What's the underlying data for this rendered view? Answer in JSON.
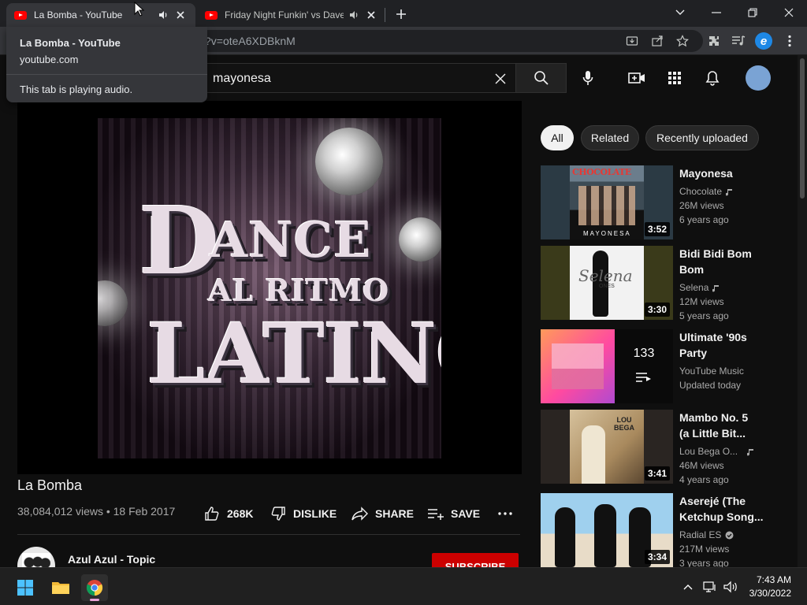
{
  "browser": {
    "tabs": [
      {
        "title": "La Bomba - YouTube",
        "active": true
      },
      {
        "title": "Friday Night Funkin' vs Dave and Bambi",
        "active": false
      }
    ],
    "url_visible": "?v=oteA6XDBknM",
    "hover_card": {
      "title": "La Bomba - YouTube",
      "domain": "youtube.com",
      "audio_status": "This tab is playing audio."
    },
    "profile_letter": "e"
  },
  "youtube": {
    "search_query": "mayonesa",
    "thumbnail_art": {
      "line1_big": "D",
      "line1_rest": "ANCE",
      "line2": "AL RITMO",
      "line3": "LATINO"
    },
    "video": {
      "title": "La Bomba",
      "meta": "38,084,012 views • 18 Feb 2017",
      "likes": "268K",
      "dislike_label": "DISLIKE",
      "share_label": "SHARE",
      "save_label": "SAVE",
      "channel": "Azul Azul - Topic",
      "subscribe_label": "SUBSCRIBE"
    },
    "chips": [
      "All",
      "Related",
      "Recently uploaded"
    ],
    "related": [
      {
        "title_l1": "Mayonesa",
        "title_l2": "",
        "channel": "Chocolate",
        "views": "26M views",
        "age": "6 years ago",
        "duration": "3:52",
        "thumb_text": "CHOCOLATE",
        "thumb_sub": "MAYONESA"
      },
      {
        "title_l1": "Bidi Bidi Bom",
        "title_l2": "Bom",
        "channel": "Selena",
        "views": "12M views",
        "age": "5 years ago",
        "duration": "3:30",
        "thumb_text": "Selena",
        "thumb_sub": "ONES"
      },
      {
        "title_l1": "Ultimate '90s",
        "title_l2": "Party",
        "channel": "YouTube Music",
        "views": "Updated today",
        "age": "",
        "duration": "",
        "playlist_count": "133"
      },
      {
        "title_l1": "Mambo No. 5",
        "title_l2": "(a Little Bit...",
        "channel": "Lou Bega O...",
        "views": "46M views",
        "age": "4 years ago",
        "duration": "3:41",
        "thumb_text": "LOU BEGA"
      },
      {
        "title_l1": "Aserejé (The",
        "title_l2": "Ketchup Song...",
        "channel": "Radial ES",
        "views": "217M views",
        "age": "3 years ago",
        "duration": "3:34"
      }
    ]
  },
  "taskbar": {
    "time": "7:43 AM",
    "date": "3/30/2022"
  },
  "colors": {
    "youtube_red": "#ff0000",
    "subscribe_red": "#cc0000",
    "background": "#0f0f0f"
  }
}
